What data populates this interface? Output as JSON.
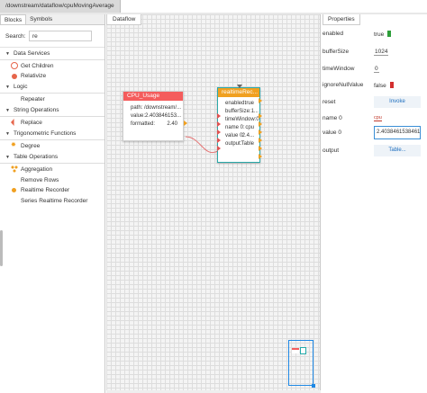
{
  "title_tab": "/downstream/dataflow/cpuMovingAverage",
  "left": {
    "tabs": [
      "Blocks",
      "Symbols"
    ],
    "search_label": "Search:",
    "search_value": "re",
    "categories": [
      {
        "name": "Data Services",
        "items": [
          "Get Children",
          "Relativize"
        ]
      },
      {
        "name": "Logic",
        "items": [
          "Repeater"
        ]
      },
      {
        "name": "String Operations",
        "items": [
          "Replace"
        ]
      },
      {
        "name": "Trigonometric Functions",
        "items": [
          "Degree"
        ]
      },
      {
        "name": "Table Operations",
        "items": [
          "Aggregation",
          "Remove Rows",
          "Realtime Recorder",
          "Series Realtime Recorder"
        ]
      }
    ]
  },
  "center": {
    "tab": "Dataflow",
    "cpu_block": {
      "title": "CPU_Usage",
      "rows": [
        {
          "label": "path: /downstream/...",
          "value": ""
        },
        {
          "label": "value:2.403846153...",
          "value": ""
        },
        {
          "label": "formatted:",
          "value": "2.40"
        }
      ]
    },
    "rt_block": {
      "title": "realtimeRec...",
      "rows": [
        {
          "label": "enabled:",
          "value": "true"
        },
        {
          "label": "bufferSize:1...",
          "value": ""
        },
        {
          "label": "timeWindow:0",
          "value": ""
        },
        {
          "label": "name 0:",
          "value": "cpu"
        },
        {
          "label": "value 0:",
          "value": "2.4..."
        },
        {
          "label": "output:",
          "value": "Table"
        }
      ]
    }
  },
  "right": {
    "tab": "Properties",
    "props": {
      "enabled": {
        "name": "enabled",
        "value": "true"
      },
      "bufferSize": {
        "name": "bufferSize",
        "value": "1024"
      },
      "timeWindow": {
        "name": "timeWindow",
        "value": "0"
      },
      "ignoreNullValue": {
        "name": "ignoreNullValue",
        "value": "false"
      },
      "reset": {
        "name": "reset",
        "value": "Invoke"
      },
      "name0": {
        "name": "name 0",
        "value": "cpu"
      },
      "value0": {
        "name": "value 0",
        "value": "2.403846153846154"
      },
      "output": {
        "name": "output",
        "value": "Table..."
      }
    }
  },
  "colors": {
    "cpu_header": "#f45c5c",
    "rt_header": "#f0a020",
    "accent": "#1e88e5",
    "rt_border": "#2aa9a9"
  }
}
